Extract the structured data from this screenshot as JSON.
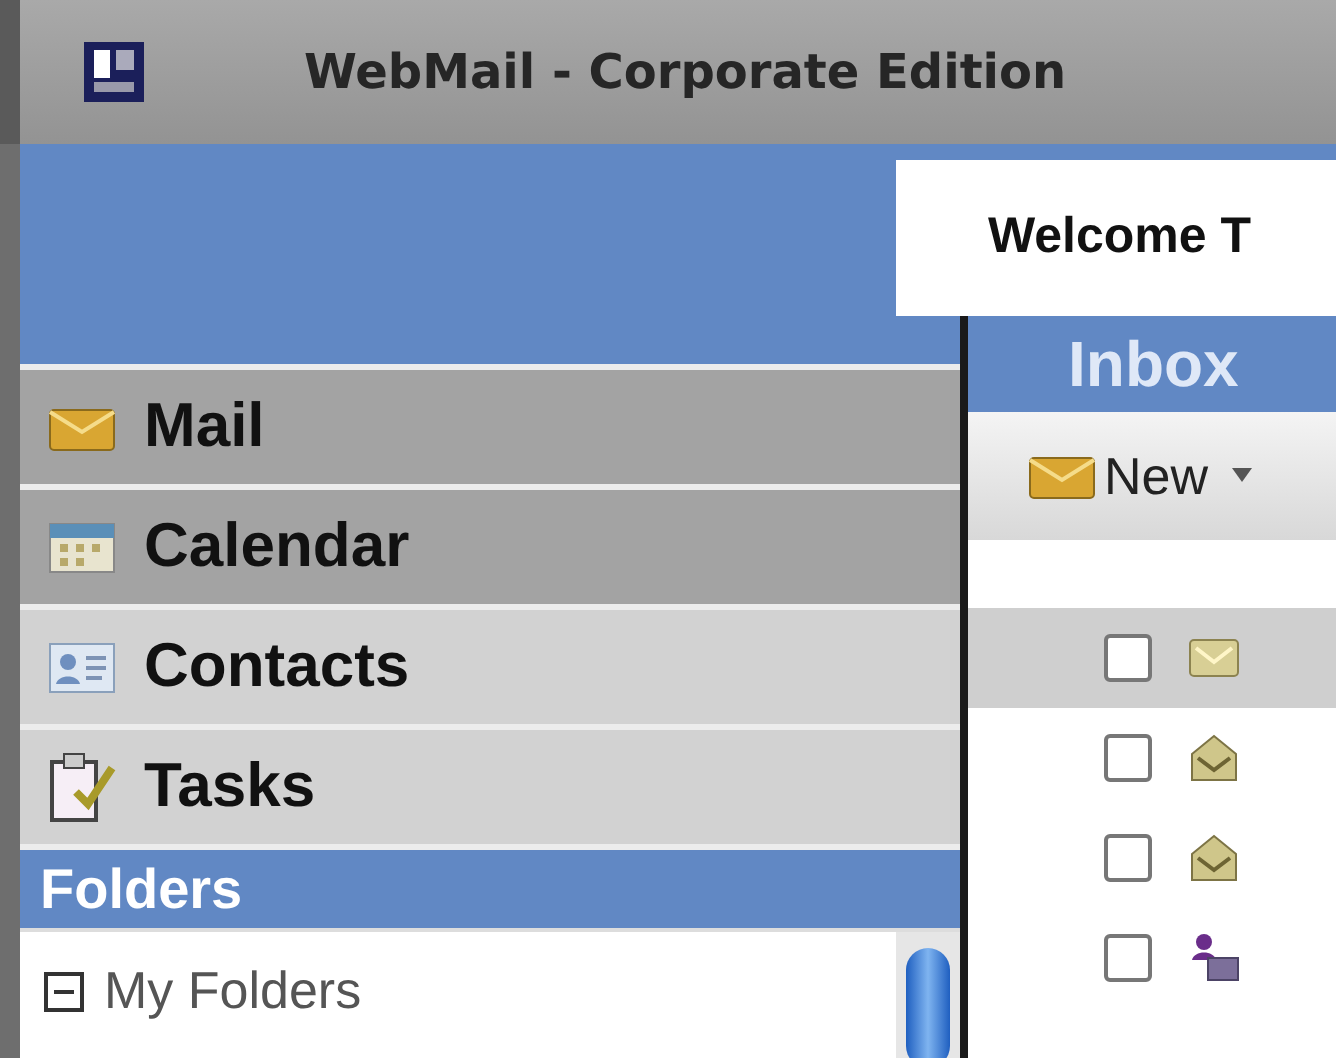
{
  "window": {
    "title": "WebMail - Corporate Edition"
  },
  "welcome": {
    "text": "Welcome T"
  },
  "nav": [
    {
      "label": "Mail",
      "kind": "mail",
      "selected": true
    },
    {
      "label": "Calendar",
      "kind": "calendar",
      "selected": true
    },
    {
      "label": "Contacts",
      "kind": "contacts",
      "selected": false
    },
    {
      "label": "Tasks",
      "kind": "tasks",
      "selected": false
    }
  ],
  "folders": {
    "title": "Folders",
    "items": [
      {
        "label": "My Folders",
        "expanded": true
      }
    ]
  },
  "inbox": {
    "title": "Inbox",
    "toolbar": [
      {
        "label": "New"
      }
    ],
    "rows": [
      {
        "kind": "closed",
        "selected": true,
        "checked": false
      },
      {
        "kind": "open",
        "selected": false,
        "checked": false
      },
      {
        "kind": "open",
        "selected": false,
        "checked": false
      },
      {
        "kind": "meeting",
        "selected": false,
        "checked": false
      }
    ]
  }
}
